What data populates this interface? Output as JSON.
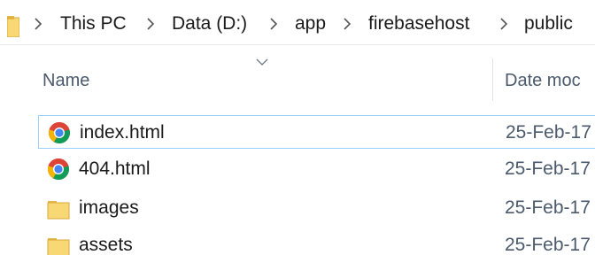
{
  "breadcrumb": {
    "items": [
      {
        "label": "This PC"
      },
      {
        "label": "Data (D:)"
      },
      {
        "label": "app"
      },
      {
        "label": "firebasehost"
      },
      {
        "label": "public"
      }
    ],
    "root_icon": "folder-icon",
    "separator_icon": "chevron-right-icon"
  },
  "columns": {
    "name": "Name",
    "date": "Date moc",
    "sort_icon": "chevron-down-icon"
  },
  "files": [
    {
      "name": "index.html",
      "date": "25-Feb-17",
      "icon": "chrome-icon",
      "selected": true
    },
    {
      "name": "404.html",
      "date": "25-Feb-17",
      "icon": "chrome-icon",
      "selected": false
    },
    {
      "name": "images",
      "date": "25-Feb-17",
      "icon": "folder-icon",
      "selected": false
    },
    {
      "name": "assets",
      "date": "25-Feb-17",
      "icon": "folder-icon",
      "selected": false
    }
  ],
  "colors": {
    "selection_border": "#99d1ff",
    "folder": "#f8d775",
    "header_text": "#4b5a6c"
  }
}
